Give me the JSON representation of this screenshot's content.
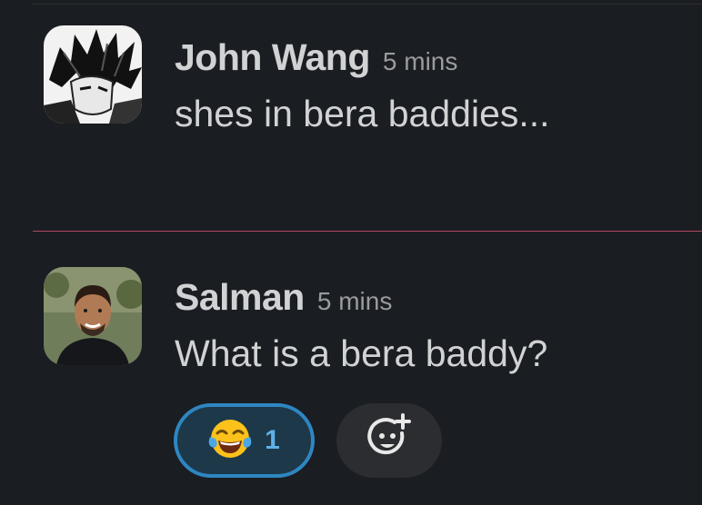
{
  "messages": [
    {
      "sender": "John Wang",
      "time": "5 mins",
      "text": "shes in bera baddies..."
    },
    {
      "sender": "Salman",
      "time": "5 mins",
      "text": "What is a bera baddy?",
      "reactions": [
        {
          "emoji": "😂",
          "icon": "tears-of-joy-emoji",
          "count": "1"
        }
      ],
      "add_reaction_icon": "add-reaction-icon"
    }
  ],
  "colors": {
    "background": "#1a1d21",
    "unread_divider": "#b14a60",
    "reaction_border": "#2e86c1",
    "reaction_count": "#5fb0e8"
  }
}
